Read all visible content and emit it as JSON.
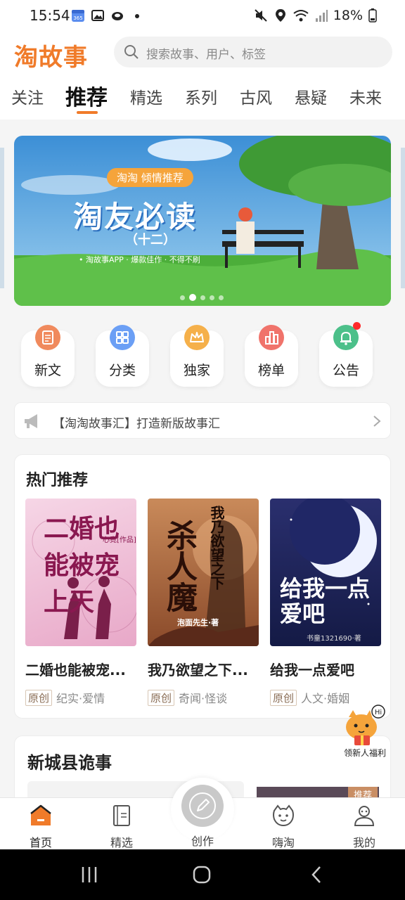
{
  "status": {
    "time": "15:54",
    "battery": "18%",
    "notif_icons": [
      "calendar-365-icon",
      "image-icon",
      "cloud-icon",
      "dot-icon"
    ],
    "sys_icons": [
      "mute-icon",
      "location-icon",
      "wifi-icon",
      "signal-icon",
      "battery-icon"
    ]
  },
  "header": {
    "logo": "淘故事",
    "search_placeholder": "搜索故事、用户、标签"
  },
  "tabs": [
    "关注",
    "推荐",
    "精选",
    "系列",
    "古风",
    "悬疑",
    "未来"
  ],
  "active_tab": "推荐",
  "banner": {
    "tag": "淘淘 倾情推荐",
    "title": "淘友必读",
    "subtitle": "（十二）",
    "note": "• 淘故事APP · 爆款佳作 · 不得不刷",
    "page_index": 2,
    "page_count": 5
  },
  "quick_menu": [
    {
      "label": "新文",
      "icon": "document-icon",
      "color": "#f08a5d"
    },
    {
      "label": "分类",
      "icon": "grid-icon",
      "color": "#6b9ff5"
    },
    {
      "label": "独家",
      "icon": "crown-icon",
      "color": "#f5b04a"
    },
    {
      "label": "榜单",
      "icon": "bar-chart-icon",
      "color": "#f0736b"
    },
    {
      "label": "公告",
      "icon": "bell-icon",
      "color": "#4cc08a"
    }
  ],
  "notice": {
    "text": "【淘淘故事汇】打造新版故事汇"
  },
  "hot": {
    "title": "热门推荐",
    "books": [
      {
        "title": "二婚也能被宠...",
        "badge": "原创",
        "genre": "纪实·爱情",
        "cover_text": "二婚也能被宠上天",
        "cover_author": "心竟[作品]"
      },
      {
        "title": "我乃欲望之下...",
        "badge": "原创",
        "genre": "奇闻·怪谈",
        "cover_text": "杀人魔",
        "cover_sub": "我乃欲望之下",
        "cover_author": "泡面先生·著"
      },
      {
        "title": "给我一点爱吧",
        "badge": "原创",
        "genre": "人文·婚姻",
        "cover_text": "给我一点爱吧",
        "cover_author": "书童1321690·著"
      }
    ]
  },
  "float_badge": {
    "label": "领新人福利",
    "hi": "Hi"
  },
  "city": {
    "title": "新城县诡事",
    "tag": "推荐"
  },
  "bottom_nav": [
    {
      "label": "首页",
      "icon": "home-icon"
    },
    {
      "label": "精选",
      "icon": "notebook-icon"
    },
    {
      "label": "创作",
      "icon": "pen-icon"
    },
    {
      "label": "嗨淘",
      "icon": "cat-face-icon"
    },
    {
      "label": "我的",
      "icon": "profile-icon"
    }
  ],
  "colors": {
    "accent": "#f07b2a",
    "badge_border": "#d8c7b5",
    "red_dot": "#ff2a2a"
  }
}
